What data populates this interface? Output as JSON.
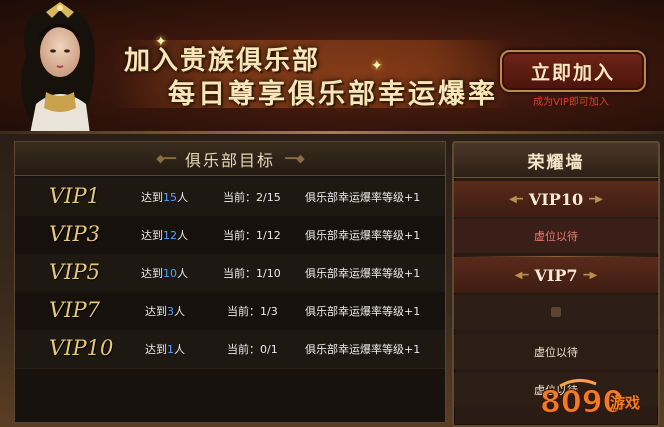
{
  "banner": {
    "line1": "加入贵族俱乐部",
    "line2": "每日尊享俱乐部幸运爆率",
    "join_button": "立即加入",
    "join_note": "成为VIP即可加入"
  },
  "club_targets": {
    "title": "俱乐部目标",
    "rows": [
      {
        "vip": "VIP1",
        "reach_prefix": "达到",
        "reach_num": "15",
        "reach_suffix": "人",
        "current": "当前：2/15",
        "bonus": "俱乐部幸运爆率等级+1"
      },
      {
        "vip": "VIP3",
        "reach_prefix": "达到",
        "reach_num": "12",
        "reach_suffix": "人",
        "current": "当前：1/12",
        "bonus": "俱乐部幸运爆率等级+1"
      },
      {
        "vip": "VIP5",
        "reach_prefix": "达到",
        "reach_num": "10",
        "reach_suffix": "人",
        "current": "当前：1/10",
        "bonus": "俱乐部幸运爆率等级+1"
      },
      {
        "vip": "VIP7",
        "reach_prefix": "达到",
        "reach_num": "3",
        "reach_suffix": "人",
        "current": "当前：1/3",
        "bonus": "俱乐部幸运爆率等级+1"
      },
      {
        "vip": "VIP10",
        "reach_prefix": "达到",
        "reach_num": "1",
        "reach_suffix": "人",
        "current": "当前：0/1",
        "bonus": "俱乐部幸运爆率等级+1"
      }
    ]
  },
  "honor_wall": {
    "title": "荣耀墙",
    "vip10": {
      "title": "VIP10",
      "slot": "虚位以待"
    },
    "vip7": {
      "title": "VIP7",
      "slot2": "虚位以待",
      "slot3": "虚位以待"
    }
  },
  "watermark": {
    "brand": "游戏"
  },
  "colors": {
    "accent_gold": "#e6c779",
    "reach_number_blue": "#4fa3ff",
    "note_red": "#e23b2c",
    "watermark_orange": "#f07b24"
  }
}
